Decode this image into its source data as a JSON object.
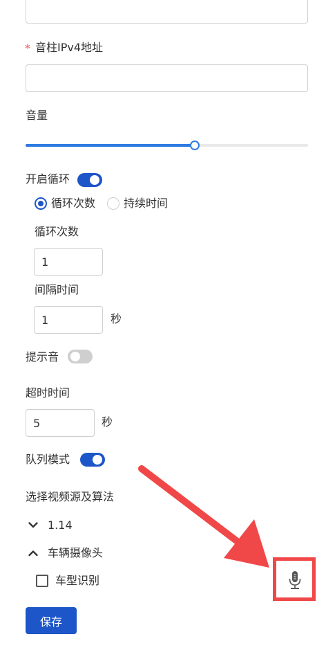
{
  "form": {
    "speaker_ip": {
      "required_mark": "*",
      "label": "音柱IPv4地址",
      "value": ""
    },
    "volume": {
      "label": "音量",
      "level_percent": 60
    },
    "loop": {
      "label": "开启循环",
      "enabled": true,
      "mode_options": [
        "循环次数",
        "持续时间"
      ],
      "selected_mode": "循环次数",
      "count": {
        "label": "循环次数",
        "value": "1"
      },
      "interval": {
        "label": "间隔时间",
        "value": "1",
        "unit": "秒"
      }
    },
    "prompt_tone": {
      "label": "提示音",
      "enabled": false
    },
    "timeout": {
      "label": "超时时间",
      "value": "5",
      "unit": "秒"
    },
    "queue_mode": {
      "label": "队列模式",
      "enabled": true
    },
    "video_source": {
      "label": "选择视频源及算法",
      "tree": [
        {
          "label": "1.14",
          "expanded": false
        },
        {
          "label": "车辆摄像头",
          "expanded": true,
          "children": [
            {
              "label": "车型识别",
              "checked": false
            }
          ]
        }
      ]
    },
    "save_label": "保存"
  },
  "colors": {
    "primary": "#1c56c8",
    "slider": "#2d7be2",
    "annotation": "#f04848"
  },
  "icons": {
    "mic": "microphone-icon"
  }
}
